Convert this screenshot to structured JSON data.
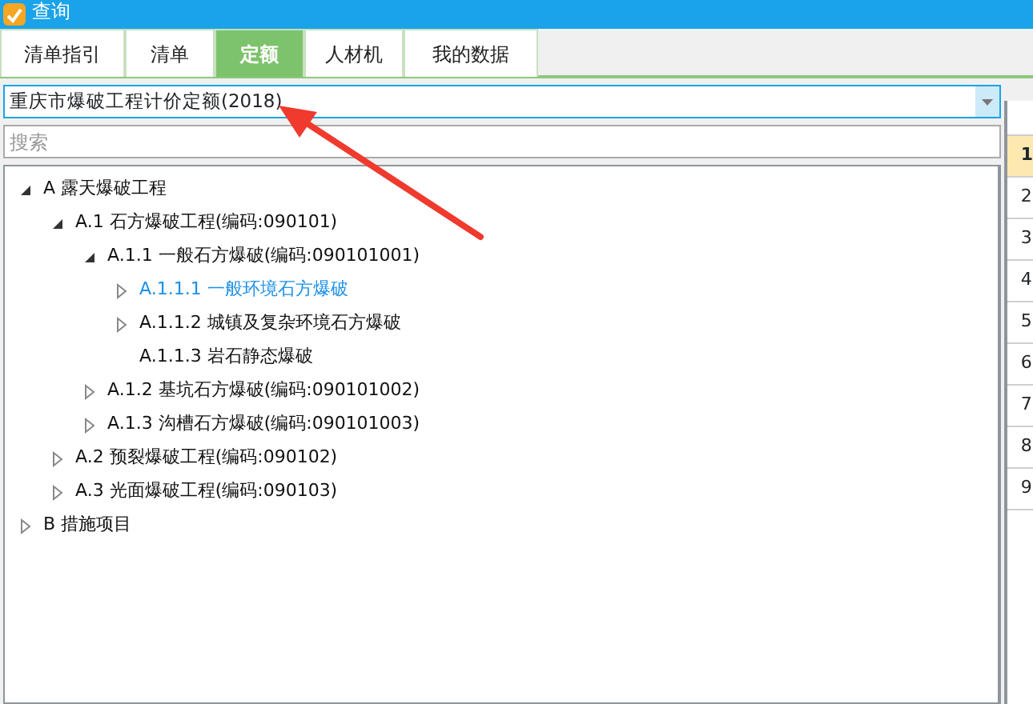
{
  "window": {
    "title": "查询"
  },
  "tabs": [
    {
      "label": "清单指引",
      "selected": false
    },
    {
      "label": "清单",
      "selected": false
    },
    {
      "label": "定额",
      "selected": true
    },
    {
      "label": "人材机",
      "selected": false
    },
    {
      "label": "我的数据",
      "selected": false
    }
  ],
  "library_select": {
    "value": "重庆市爆破工程计价定额(2018)"
  },
  "search": {
    "placeholder": "搜索"
  },
  "tree": [
    {
      "label": "A 露天爆破工程",
      "expanded": true,
      "selected": false,
      "children": [
        {
          "label": "A.1 石方爆破工程(编码:090101)",
          "expanded": true,
          "selected": false,
          "children": [
            {
              "label": "A.1.1 一般石方爆破(编码:090101001)",
              "expanded": true,
              "selected": false,
              "children": [
                {
                  "label": "A.1.1.1 一般环境石方爆破",
                  "expanded": false,
                  "selected": true
                },
                {
                  "label": "A.1.1.2 城镇及复杂环境石方爆破",
                  "expanded": false,
                  "selected": false
                },
                {
                  "label": "A.1.1.3 岩石静态爆破",
                  "selected": false
                }
              ]
            },
            {
              "label": "A.1.2 基坑石方爆破(编码:090101002)",
              "expanded": false,
              "selected": false
            },
            {
              "label": "A.1.3 沟槽石方爆破(编码:090101003)",
              "expanded": false,
              "selected": false
            }
          ]
        },
        {
          "label": "A.2 预裂爆破工程(编码:090102)",
          "expanded": false,
          "selected": false
        },
        {
          "label": "A.3 光面爆破工程(编码:090103)",
          "expanded": false,
          "selected": false
        }
      ]
    },
    {
      "label": "B 措施项目",
      "expanded": false,
      "selected": false
    }
  ],
  "row_numbers": [
    {
      "label": "1",
      "selected": true
    },
    {
      "label": "2",
      "selected": false
    },
    {
      "label": "3",
      "selected": false
    },
    {
      "label": "4",
      "selected": false
    },
    {
      "label": "5",
      "selected": false
    },
    {
      "label": "6",
      "selected": false
    },
    {
      "label": "7",
      "selected": false
    },
    {
      "label": "8",
      "selected": false
    },
    {
      "label": "9",
      "selected": false
    }
  ]
}
